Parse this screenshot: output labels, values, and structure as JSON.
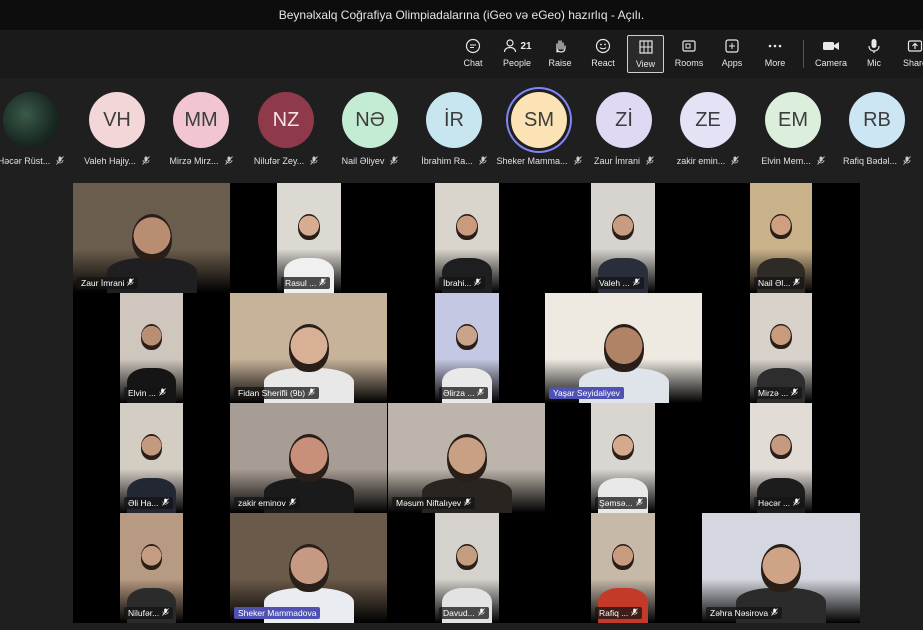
{
  "window": {
    "title": "Beynəlxalq Coğrafiya Olimpiadalarına (iGeo və eGeo) hazırlıq - Açılı."
  },
  "toolbar": {
    "chat": "Chat",
    "people": "People",
    "people_count": "21",
    "raise": "Raise",
    "react": "React",
    "view": "View",
    "rooms": "Rooms",
    "apps": "Apps",
    "more": "More",
    "camera": "Camera",
    "mic": "Mic",
    "share": "Share"
  },
  "avatars": [
    {
      "initials": "",
      "name": "Həcər Rüst...",
      "color": "#000000"
    },
    {
      "initials": "VH",
      "name": "Valeh Hajiy...",
      "color": "#f3d6d8"
    },
    {
      "initials": "MM",
      "name": "Mirzə Mirz...",
      "color": "#f1c6d0"
    },
    {
      "initials": "NZ",
      "name": "Nilufər Zey...",
      "color": "#8e3a4a"
    },
    {
      "initials": "NƏ",
      "name": "Nail Əliyev",
      "color": "#c4ecd4"
    },
    {
      "initials": "İR",
      "name": "İbrahim Ra...",
      "color": "#c8e6f0"
    },
    {
      "initials": "SM",
      "name": "Sheker Mamma...",
      "color": "#fbe3b6"
    },
    {
      "initials": "Zİ",
      "name": "Zaur İmrani",
      "color": "#dfd9f3"
    },
    {
      "initials": "ZE",
      "name": "zakir emin...",
      "color": "#e4e2f5"
    },
    {
      "initials": "EM",
      "name": "Elvin Mem...",
      "color": "#dcefdc"
    },
    {
      "initials": "RB",
      "name": "Rafiq Bədəl...",
      "color": "#cde6f3"
    }
  ],
  "tiles": [
    {
      "name": "Zaur İmrani",
      "bg": "#6a5d4d",
      "skin": "#b98d72",
      "shirt": "#1f1f22"
    },
    {
      "name": "Rasul ...",
      "bg": "#dcd8d2",
      "skin": "#d6ad90",
      "shirt": "#f0f0f0"
    },
    {
      "name": "İbrahi...",
      "bg": "#d9d4cc",
      "skin": "#c99a7e",
      "shirt": "#1e1e20"
    },
    {
      "name": "Valeh ...",
      "bg": "#d7d4cf",
      "skin": "#c79c80",
      "shirt": "#2a2e3a"
    },
    {
      "name": "Nail Əl...",
      "bg": "#c9b28a",
      "skin": "#cf9f80",
      "shirt": "#2e2a26"
    },
    {
      "name": "Elvin ...",
      "bg": "#cfc7bd",
      "skin": "#b98f74",
      "shirt": "#151515"
    },
    {
      "name": "Fidan Sherifli (9b)",
      "bg": "#c7b29a",
      "skin": "#d8b096",
      "shirt": "#e8e8e8"
    },
    {
      "name": "Əlirza ...",
      "bg": "#c5c8e2",
      "skin": "#c8a48a",
      "shirt": "#e9e9e9"
    },
    {
      "name": "Yaşar Seyidaliyev",
      "bg": "#eeeae2",
      "skin": "#b08366",
      "shirt": "#dfe3ea"
    },
    {
      "name": "Mirzə ...",
      "bg": "#d8d2cb",
      "skin": "#c99b7d",
      "shirt": "#2d2d2d"
    },
    {
      "name": "Əli Ha...",
      "bg": "#d3cdc4",
      "skin": "#c49a7e",
      "shirt": "#222733"
    },
    {
      "name": "zakir eminov",
      "bg": "#a89d94",
      "skin": "#c88f7a",
      "shirt": "#1a1a1a"
    },
    {
      "name": "Məsum Niftalıyev",
      "bg": "#bdb5ab",
      "skin": "#c9a084",
      "shirt": "#2a2420"
    },
    {
      "name": "Şəmsə...",
      "bg": "#d9d6d2",
      "skin": "#d4a98c",
      "shirt": "#e9e9e9"
    },
    {
      "name": "Həcər ...",
      "bg": "#e1dcd6",
      "skin": "#c69a80",
      "shirt": "#1c1c1c"
    },
    {
      "name": "Nilufər...",
      "bg": "#b79a82",
      "skin": "#c59c82",
      "shirt": "#2b2b2b"
    },
    {
      "name": "Sheker Mammadova",
      "bg": "#6a5a4a",
      "skin": "#c69a82",
      "shirt": "#e9ecf0"
    },
    {
      "name": "Davud...",
      "bg": "#d5d2cd",
      "skin": "#c49c80",
      "shirt": "#e3e3e3"
    },
    {
      "name": "Rafiq ...",
      "bg": "#c6b9a8",
      "skin": "#c89b7e",
      "shirt": "#c43a2a"
    },
    {
      "name": "Zəhra Nəsirova",
      "bg": "#d4d7df",
      "skin": "#cfa386",
      "shirt": "#2b2b2b"
    }
  ]
}
